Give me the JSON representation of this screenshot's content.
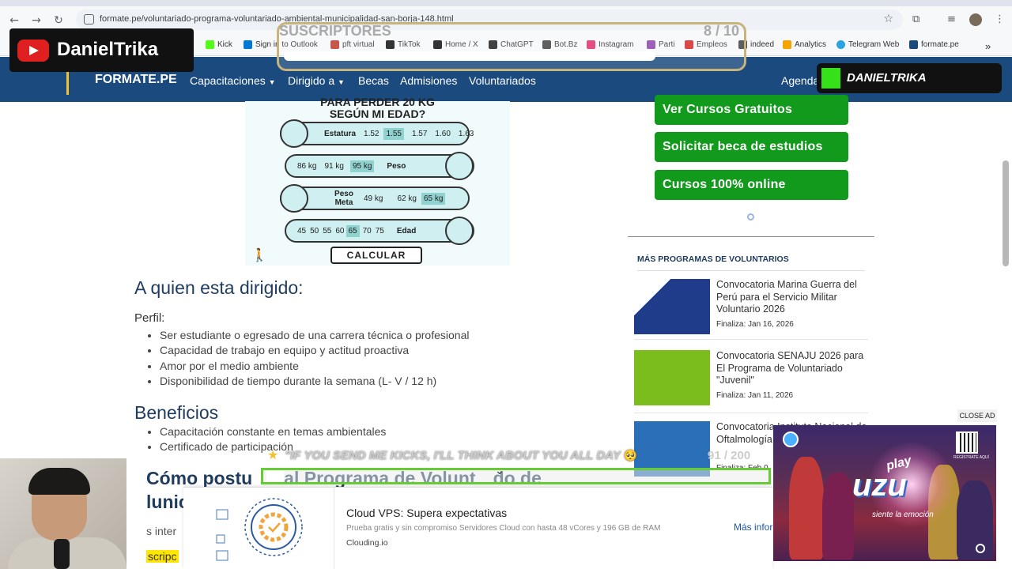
{
  "browser": {
    "url": "formate.pe/voluntariado-programa-voluntariado-ambiental-municipalidad-san-borja-148.html",
    "bookmarks": [
      "Kick",
      "Sign in to Outlook",
      "pft virtual",
      "TikTok",
      "Home / X",
      "ChatGPT",
      "Bot.Bz",
      "Instagram",
      "Parti",
      "Empleos",
      "indeed",
      "Analytics",
      "Telegram Web",
      "formate.pe"
    ],
    "bookmark_colors": [
      "#53fc18",
      "#0078d4",
      "#c0392b",
      "#111111",
      "#111111",
      "#222222",
      "#444444",
      "#e1306c",
      "#8e44ad",
      "#d62828",
      "#444444",
      "#f4a300",
      "#2aa3e0",
      "#1b4a7e"
    ]
  },
  "site": {
    "logo": "FORMATE.PE",
    "nav": [
      "Capacitaciones",
      "Dirigido a",
      "Becas",
      "Admisiones",
      "Voluntariados",
      "Agenda"
    ]
  },
  "overlay": {
    "yt_name": "DanielTrika",
    "subs_label": "SUSCRIPTORES",
    "subs_count": "8 / 10",
    "kick_name": "DANIELTRIKA",
    "alert_text": "\"IF YOU SEND ME KICKS, I'LL THINK ABOUT YOU ALL DAY",
    "alert_emoji": "🥺",
    "alert_count": "91 / 200"
  },
  "calculator": {
    "heading_line1": "PARA PERDER 20 KG",
    "heading_line2": "SEGÚN MI EDAD?",
    "estatura_label": "Estatura",
    "estatura_values": [
      "1.52",
      "1.55",
      "1.57",
      "1.60",
      "1.63"
    ],
    "peso_label": "Peso",
    "peso_values": [
      "86 kg",
      "91 kg",
      "95 kg"
    ],
    "peso_meta_label": "Peso Meta",
    "peso_meta_values": [
      "49 kg",
      "62 kg",
      "65 kg"
    ],
    "edad_label": "Edad",
    "edad_values": [
      "45",
      "50",
      "55",
      "60",
      "65",
      "70",
      "75"
    ],
    "button": "CALCULAR"
  },
  "content": {
    "dirigido_title": "A quien esta dirigido:",
    "perfil_label": "Perfil:",
    "perfil_items": [
      "Ser estudiante o egresado de una carrera técnica o profesional",
      "Capacidad de trabajo en equipo y actitud proactiva",
      "Amor por el medio ambiente",
      "Disponibilidad de tiempo durante la semana (L- V / 12 h)"
    ],
    "beneficios_title": "Beneficios",
    "beneficios_items": [
      "Capacitación constante en temas ambientales",
      "Certificado de participación"
    ],
    "como_title_a": "Cómo postu",
    "como_title_b": "al Programa de Volunt",
    "como_title_c": "do de",
    "como_title_line2": "lunic",
    "es_inter": "s inter",
    "inscrip": "scripc"
  },
  "sidebar": {
    "buttons": [
      "Ver Cursos Gratuitos",
      "Solicitar beca de estudios",
      "Cursos 100% online"
    ],
    "section_title": "MÁS PROGRAMAS DE VOLUNTARIOS",
    "programs": [
      {
        "title": "Convocatoria Marina Guerra del Perú para el Servicio Militar Voluntario 2026",
        "date": "Finaliza: Jan 16, 2026",
        "thumb_color": "#1e3c8a"
      },
      {
        "title": "Convocatoria SENAJU 2026 para El Programa de Voluntariado \"Juvenil\"",
        "date": "Finaliza: Jan 11, 2026",
        "thumb_color": "#7cbd1e"
      },
      {
        "title": "Convocatoria Instituto Nacional de Oftalmología 2026 de Pasantías",
        "date": "Finaliza: Feb 0",
        "thumb_color": "#2a6fb8"
      }
    ]
  },
  "ads": {
    "cloud_title": "Cloud VPS: Supera expectativas",
    "cloud_desc": "Prueba gratis y sin compromiso Servidores Cloud con hasta 48 vCores y 196 GB de RAM",
    "cloud_brand": "Clouding.io",
    "cloud_more": "Más infor",
    "close_ad": "CLOSE AD",
    "video_play": "play",
    "video_brand": "uzu",
    "video_tag": "siente la emoción",
    "video_qr_label": "REGÍSTRATE AQUÍ"
  }
}
